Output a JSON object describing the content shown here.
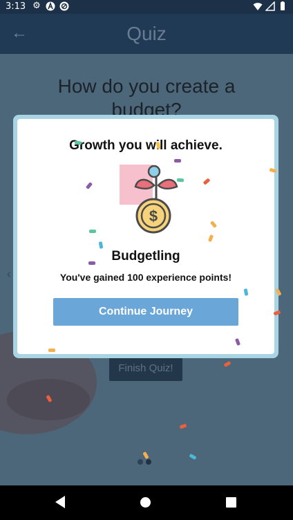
{
  "status_bar": {
    "time": "3:13",
    "left_icons": [
      "gear-icon",
      "a-icon",
      "blocked-icon"
    ],
    "right_icons": [
      "wifi-icon",
      "signal-icon",
      "battery-icon"
    ]
  },
  "app_bar": {
    "title": "Quiz",
    "back_icon": "arrow-left-icon"
  },
  "question": {
    "text": "How do you create a budget?"
  },
  "finish_button": {
    "label": "Finish Quiz!"
  },
  "dialog": {
    "title": "Growth you will achieve.",
    "badge_icon": "money-plant-icon",
    "badge_name": "Budgetling",
    "xp_message": "You've gained 100 experience points!",
    "continue_label": "Continue Journey"
  },
  "colors": {
    "app_bar": "#203a56",
    "dialog_border": "#a9d4e3",
    "continue_button": "#6aa6d8",
    "coin": "#f6d37a",
    "leaf": "#e8707a"
  },
  "nav_bar": {
    "icons": [
      "back-triangle-icon",
      "home-circle-icon",
      "recents-square-icon"
    ]
  }
}
